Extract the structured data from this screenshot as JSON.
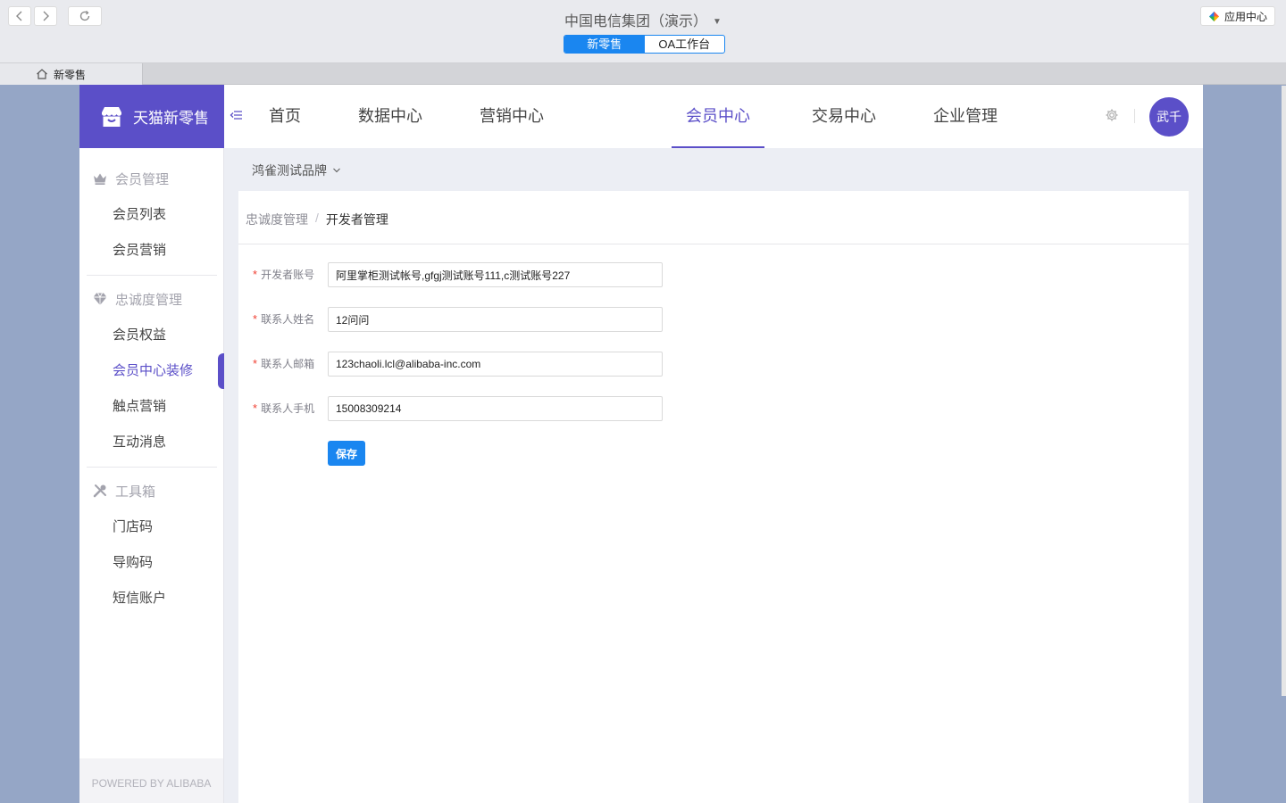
{
  "window": {
    "org_title": "中国电信集团（演示）",
    "segments": [
      "新零售",
      "OA工作台"
    ],
    "active_segment": 0,
    "app_center_label": "应用中心",
    "page_tab_label": "新零售"
  },
  "app": {
    "brand_name": "天猫新零售",
    "nav": [
      "首页",
      "数据中心",
      "营销中心",
      "会员中心",
      "交易中心",
      "企业管理"
    ],
    "active_nav": "会员中心",
    "avatar_text": "武千",
    "brand_selector": "鸿雀测试品牌",
    "powered_by": "POWERED BY ALIBABA"
  },
  "sidebar": {
    "groups": [
      {
        "title": "会员管理",
        "icon": "crown-icon",
        "items": [
          "会员列表",
          "会员营销"
        ]
      },
      {
        "title": "忠诚度管理",
        "icon": "diamond-icon",
        "items": [
          "会员权益",
          "会员中心装修",
          "触点营销",
          "互动消息"
        ]
      },
      {
        "title": "工具箱",
        "icon": "tools-icon",
        "items": [
          "门店码",
          "导购码",
          "短信账户"
        ]
      }
    ],
    "active_item": "会员中心装修"
  },
  "breadcrumb": [
    "忠诚度管理",
    "开发者管理"
  ],
  "form": {
    "fields": [
      {
        "label": "开发者账号",
        "value": "阿里掌柜测试帐号,gfgj测试账号111,c测试账号227",
        "required": true
      },
      {
        "label": "联系人姓名",
        "value": "12问问",
        "required": true
      },
      {
        "label": "联系人邮箱",
        "value": "123chaoli.lcl@alibaba-inc.com",
        "required": true
      },
      {
        "label": "联系人手机",
        "value": "15008309214",
        "required": true
      }
    ],
    "save_label": "保存"
  },
  "colors": {
    "primary": "#5b4fc8",
    "button_blue": "#1a86f0",
    "required_star": "#f04134",
    "outer_background": "#95a6c6"
  }
}
